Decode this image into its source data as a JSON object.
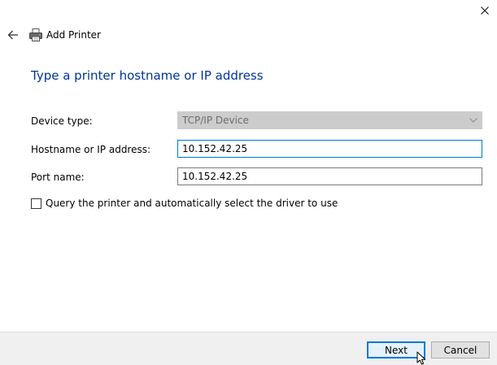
{
  "window": {
    "header_title": "Add Printer",
    "close_glyph": "✕"
  },
  "page": {
    "title": "Type a printer hostname or IP address"
  },
  "form": {
    "device_type": {
      "label": "Device type:",
      "value": "TCP/IP Device"
    },
    "hostname": {
      "label": "Hostname or IP address:",
      "value": "10.152.42.25"
    },
    "port_name": {
      "label": "Port name:",
      "value": "10.152.42.25"
    },
    "query_driver": {
      "label": "Query the printer and automatically select the driver to use",
      "checked": false
    }
  },
  "footer": {
    "next_label": "Next",
    "cancel_label": "Cancel"
  },
  "icons": {
    "back": "arrow-left-icon",
    "printer": "printer-icon",
    "close": "close-icon",
    "dropdown": "chevron-down-icon",
    "cursor": "mouse-cursor-icon"
  },
  "colors": {
    "title_blue": "#003399",
    "focus_blue": "#0078d7",
    "footer_bg": "#f0f0f0",
    "disabled_bg": "#cccccc"
  }
}
